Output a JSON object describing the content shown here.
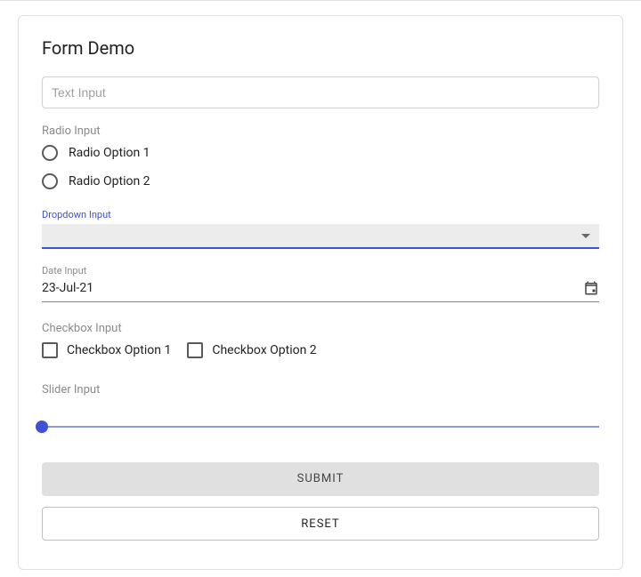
{
  "title": "Form Demo",
  "textInput": {
    "placeholder": "Text Input",
    "value": ""
  },
  "radio": {
    "label": "Radio Input",
    "options": [
      "Radio Option 1",
      "Radio Option 2"
    ]
  },
  "dropdown": {
    "label": "Dropdown Input",
    "value": ""
  },
  "date": {
    "label": "Date Input",
    "value": "23-Jul-21"
  },
  "checkbox": {
    "label": "Checkbox Input",
    "options": [
      "Checkbox Option 1",
      "Checkbox Option 2"
    ]
  },
  "slider": {
    "label": "Slider Input",
    "value": 0
  },
  "buttons": {
    "submit": "SUBMIT",
    "reset": "RESET"
  }
}
